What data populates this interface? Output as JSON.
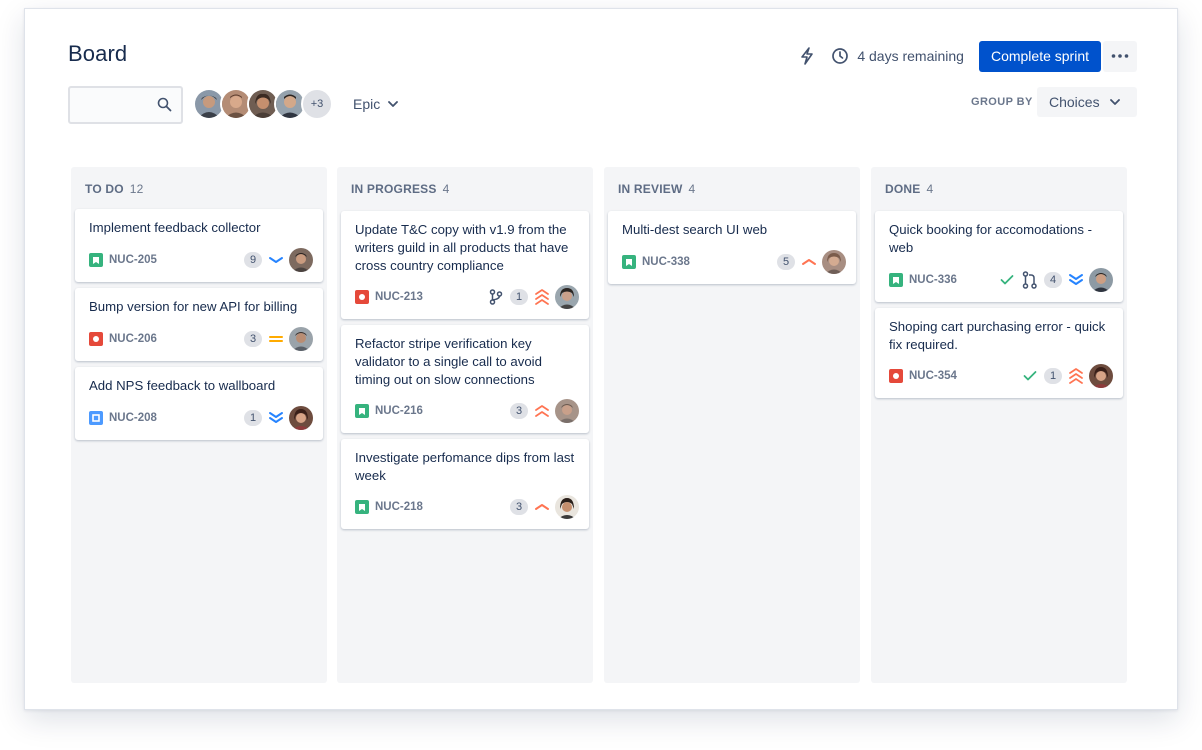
{
  "header": {
    "title": "Board",
    "remaining": "4 days remaining",
    "complete_label": "Complete sprint",
    "more_label": "•••"
  },
  "filters": {
    "search_placeholder": "",
    "avatars_more": "+3",
    "epic_label": "Epic",
    "group_by_label": "GROUP BY",
    "group_by_value": "Choices"
  },
  "colors": {
    "story": "#36B37E",
    "bug": "#E5493A",
    "task": "#4C9AFF",
    "priority_high": "#FF7452",
    "priority_low": "#2684FF",
    "priority_medium": "#FFAB00",
    "done_check": "#36B37E"
  },
  "columns": [
    {
      "name": "TO DO",
      "count": "12",
      "cards": [
        {
          "title": "Implement feedback collector",
          "key": "NUC-205",
          "type": "story",
          "estimate": "9",
          "priority": "low"
        },
        {
          "title": "Bump version for new API for billing",
          "key": "NUC-206",
          "type": "bug",
          "estimate": "3",
          "priority": "medium"
        },
        {
          "title": "Add NPS feedback to wallboard",
          "key": "NUC-208",
          "type": "task",
          "estimate": "1",
          "priority": "lowest"
        }
      ]
    },
    {
      "name": "IN PROGRESS",
      "count": "4",
      "cards": [
        {
          "title": "Update T&C copy with v1.9 from the writers guild in all products that have cross country compliance",
          "key": "NUC-213",
          "type": "bug",
          "estimate": "1",
          "priority": "highest",
          "branch": true
        },
        {
          "title": "Refactor stripe verification key validator to a single call to avoid timing out on slow connections",
          "key": "NUC-216",
          "type": "story",
          "estimate": "3",
          "priority": "highest"
        },
        {
          "title": "Investigate perfomance dips from last week",
          "key": "NUC-218",
          "type": "story",
          "estimate": "3",
          "priority": "high"
        }
      ]
    },
    {
      "name": "IN REVIEW",
      "count": "4",
      "cards": [
        {
          "title": "Multi-dest search UI web",
          "key": "NUC-338",
          "type": "story",
          "estimate": "5",
          "priority": "high"
        }
      ]
    },
    {
      "name": "DONE",
      "count": "4",
      "cards": [
        {
          "title": "Quick booking for accomodations - web",
          "key": "NUC-336",
          "type": "story",
          "estimate": "4",
          "priority": "lowest",
          "done": true,
          "pullrequest": true
        },
        {
          "title": "Shoping cart purchasing error - quick fix required.",
          "key": "NUC-354",
          "type": "bug",
          "estimate": "1",
          "priority": "highest",
          "done": true
        }
      ]
    }
  ]
}
